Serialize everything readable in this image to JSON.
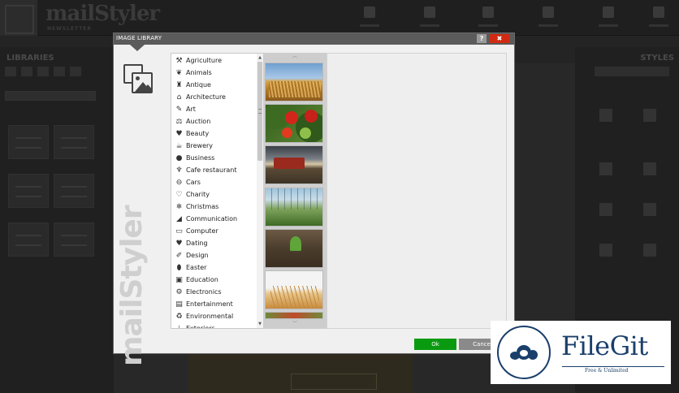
{
  "app": {
    "brand": "mailStyler",
    "brand_sub": "NEWSLETTER",
    "left_panel_title": "LIBRARIES",
    "right_panel_title": "STYLES"
  },
  "dialog": {
    "title": "IMAGE LIBRARY",
    "help_label": "?",
    "close_label": "✖",
    "watermark": "mailStyler",
    "ok_label": "Ok",
    "cancel_label": "Cancel"
  },
  "categories": [
    {
      "label": "Agriculture",
      "icon": "tractor-icon",
      "glyph": "⚒"
    },
    {
      "label": "Animals",
      "icon": "paw-icon",
      "glyph": "❦"
    },
    {
      "label": "Antique",
      "icon": "vase-icon",
      "glyph": "♜"
    },
    {
      "label": "Architecture",
      "icon": "arch-icon",
      "glyph": "⌂"
    },
    {
      "label": "Art",
      "icon": "easel-icon",
      "glyph": "✎"
    },
    {
      "label": "Auction",
      "icon": "gavel-icon",
      "glyph": "⚖"
    },
    {
      "label": "Beauty",
      "icon": "lipstick-icon",
      "glyph": "♥"
    },
    {
      "label": "Brewery",
      "icon": "beer-icon",
      "glyph": "☕"
    },
    {
      "label": "Business",
      "icon": "globe-icon",
      "glyph": "●"
    },
    {
      "label": "Cafe restaurant",
      "icon": "cutlery-icon",
      "glyph": "♆"
    },
    {
      "label": "Cars",
      "icon": "car-icon",
      "glyph": "⊖"
    },
    {
      "label": "Charity",
      "icon": "hands-icon",
      "glyph": "♡"
    },
    {
      "label": "Christmas",
      "icon": "bell-icon",
      "glyph": "❄"
    },
    {
      "label": "Communication",
      "icon": "megaphone-icon",
      "glyph": "◢"
    },
    {
      "label": "Computer",
      "icon": "monitor-icon",
      "glyph": "▭"
    },
    {
      "label": "Dating",
      "icon": "couple-icon",
      "glyph": "♥"
    },
    {
      "label": "Design",
      "icon": "pen-icon",
      "glyph": "✐"
    },
    {
      "label": "Easter",
      "icon": "egg-icon",
      "glyph": "⬮"
    },
    {
      "label": "Education",
      "icon": "book-icon",
      "glyph": "▣"
    },
    {
      "label": "Electronics",
      "icon": "chip-icon",
      "glyph": "⚙"
    },
    {
      "label": "Entertainment",
      "icon": "film-icon",
      "glyph": "▤"
    },
    {
      "label": "Environmental",
      "icon": "recycle-icon",
      "glyph": "♻"
    },
    {
      "label": "Exteriors",
      "icon": "lamp-icon",
      "glyph": "⊥"
    }
  ],
  "badge": {
    "name": "FileGit",
    "tagline": "Free & Unlimited"
  }
}
